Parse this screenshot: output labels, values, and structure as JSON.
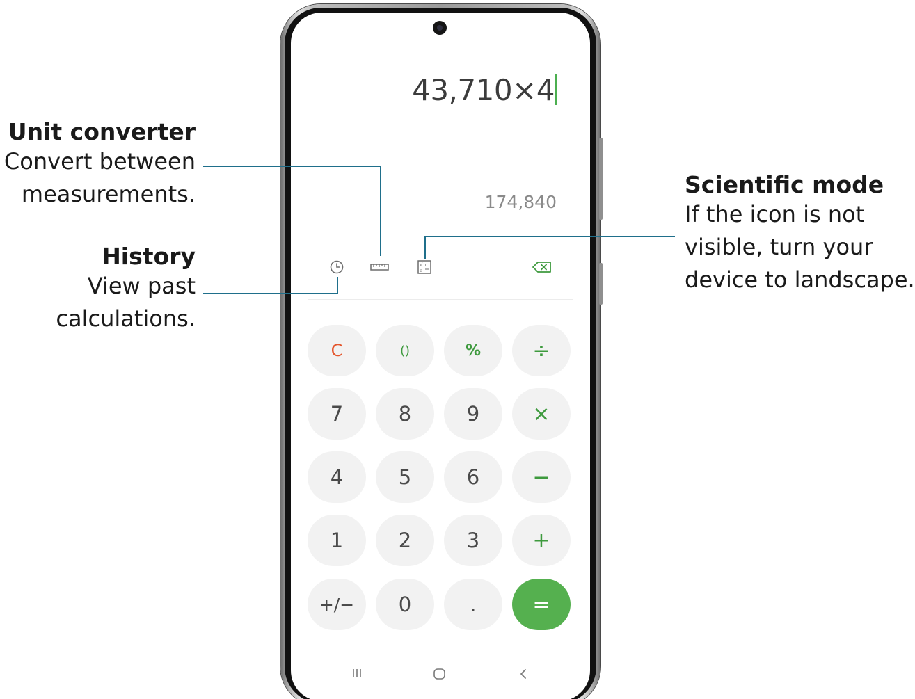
{
  "annotations": {
    "unit_converter": {
      "heading": "Unit converter",
      "desc_line1": "Convert between",
      "desc_line2": "measurements."
    },
    "history": {
      "heading": "History",
      "desc_line1": "View past",
      "desc_line2": "calculations."
    },
    "scientific_mode": {
      "heading": "Scientific mode",
      "desc_line1": "If the icon is not",
      "desc_line2": "visible, turn your",
      "desc_line3": "device to landscape."
    }
  },
  "calculator": {
    "expression": "43,710×4",
    "result": "174,840",
    "toolbar_icons": [
      "history-icon",
      "ruler-icon",
      "scientific-icon",
      "backspace-icon"
    ],
    "keys": {
      "clear": "C",
      "parens": "()",
      "percent": "%",
      "divide": "÷",
      "seven": "7",
      "eight": "8",
      "nine": "9",
      "multiply": "×",
      "four": "4",
      "five": "5",
      "six": "6",
      "minus": "−",
      "one": "1",
      "two": "2",
      "three": "3",
      "plus": "+",
      "plus_minus": "+/−",
      "zero": "0",
      "decimal": ".",
      "equals": "="
    }
  },
  "navbar": {
    "icons": [
      "recents-icon",
      "home-icon",
      "back-icon"
    ]
  },
  "colors": {
    "accent": "#55b04f",
    "operator": "#3e9a3e",
    "clear": "#e4572e",
    "leader_line": "#1f6f8b"
  }
}
